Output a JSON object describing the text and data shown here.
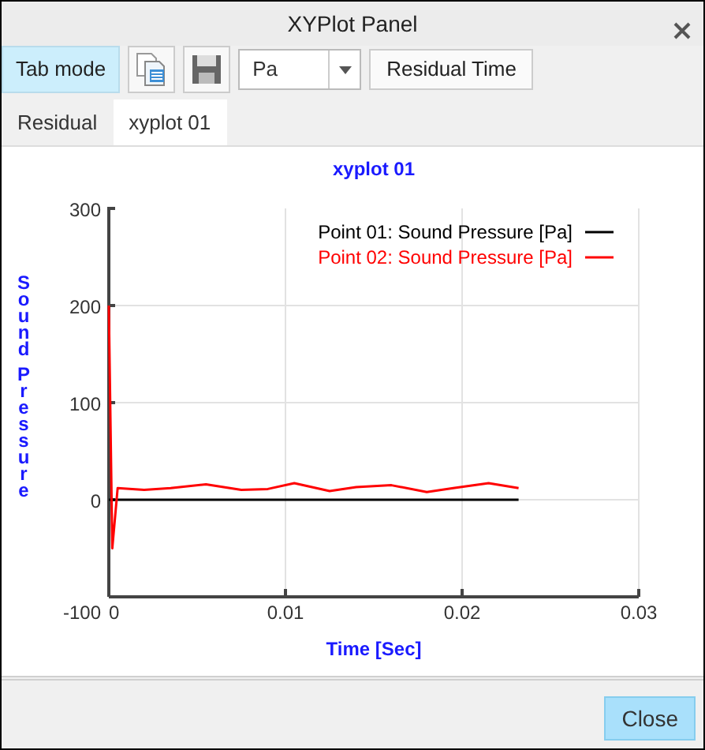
{
  "window": {
    "title": "XYPlot Panel"
  },
  "toolbar": {
    "tab_mode": {
      "label": "Tab mode",
      "on": true
    },
    "unit": {
      "value": "Pa"
    },
    "residual_time": {
      "label": "Residual Time"
    }
  },
  "tabs": [
    {
      "label": "Residual",
      "selected": false
    },
    {
      "label": "xyplot 01",
      "selected": true
    }
  ],
  "plot": {
    "chart_data": {
      "type": "line",
      "title": "xyplot 01",
      "xlabel": "Time [Sec]",
      "ylabel": "Sound Pressure",
      "x": [
        0,
        0.0002,
        0.0005,
        0.002,
        0.0035,
        0.0055,
        0.0075,
        0.009,
        0.0105,
        0.0125,
        0.014,
        0.016,
        0.018,
        0.0195,
        0.0215,
        0.0232
      ],
      "series": [
        {
          "name": "Point 01: Sound Pressure [Pa]",
          "color": "#000000",
          "values": [
            0,
            0,
            0,
            0,
            0,
            0,
            0,
            0,
            0,
            0,
            0,
            0,
            0,
            0,
            0,
            0
          ]
        },
        {
          "name": "Point 02: Sound Pressure [Pa]",
          "color": "#ff0000",
          "values": [
            200,
            -50,
            12,
            10,
            12,
            16,
            10,
            11,
            17,
            9,
            13,
            15,
            8,
            12,
            17,
            12
          ]
        }
      ],
      "xlim": [
        0,
        0.03
      ],
      "ylim": [
        -100,
        300
      ],
      "xticks": [
        0,
        0.01,
        0.02,
        0.03
      ],
      "yticks": [
        -100,
        0,
        100,
        200,
        300
      ],
      "grid": true,
      "legend": "upper right"
    }
  },
  "buttons": [
    {
      "label": "Close"
    }
  ]
}
